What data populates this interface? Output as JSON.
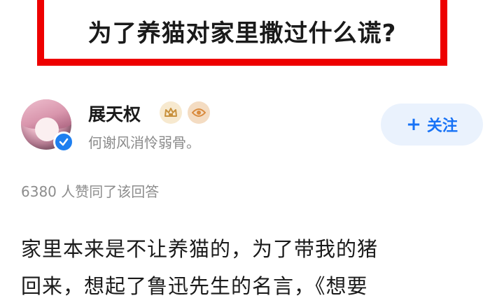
{
  "question": {
    "title": "为了养猫对家里撒过什么谎?"
  },
  "author": {
    "name": "展天权",
    "bio": "何谢风消怜弱骨。",
    "follow_label": "关注",
    "follow_icon": "plus-icon",
    "badges": [
      "crown-badge-icon",
      "eye-badge-icon"
    ]
  },
  "answer": {
    "likes_text": "6380 人赞同了该回答",
    "body_lines": [
      "家里本来是不让养猫的，为了带我的猪",
      "回来，想起了鲁迅先生的名言，《想要"
    ]
  },
  "colors": {
    "frame_red": "#ee0000",
    "accent_blue": "#1772f6",
    "follow_bg": "#eaf2fd"
  }
}
